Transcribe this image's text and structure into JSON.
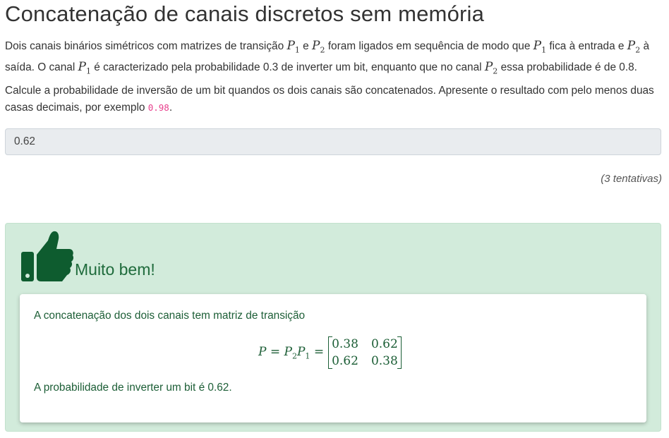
{
  "title": "Concatenação de canais discretos sem memória",
  "intro": {
    "t1": "Dois canais binários simétricos com matrizes de transição ",
    "m1": "P",
    "s1": "1",
    "t2": " e ",
    "m2": "P",
    "s2": "2",
    "t3": " foram ligados em sequência de modo que ",
    "m3": "P",
    "s3": "1",
    "t4": " fica à entrada e ",
    "m4": "P",
    "s4": "2",
    "t5": " à saída. O canal ",
    "m5": "P",
    "s5": "1",
    "t6": " é caracterizado pela probabilidade 0.3 de inverter um bit, enquanto que no canal ",
    "m6": "P",
    "s6": "2",
    "t7": " essa probabilidade é de 0.8."
  },
  "instruction": {
    "text": "Calcule a probabilidade de inversão de um bit quandos os dois canais são concatenados. Apresente o resultado com pelo menos duas casas decimais, por exemplo ",
    "example": "0.98",
    "end": "."
  },
  "answer": {
    "value": "0.62"
  },
  "attempts": "(3 tentativas)",
  "feedback": {
    "title": "Muito bem!",
    "icon": "thumbs-up-icon",
    "line1": "A concatenação dos dois canais tem matriz de transição",
    "equation": {
      "lhs_p": "P",
      "eq1": "=",
      "p2": "P",
      "p2sub": "2",
      "p1": "P",
      "p1sub": "1",
      "eq2": "=",
      "matrix": [
        "0.38",
        "0.62",
        "0.62",
        "0.38"
      ]
    },
    "line2": "A probabilidade de inverter um bit é 0.62."
  },
  "colors": {
    "success_bg": "#d2ebdb",
    "success_text": "#1c5e36",
    "code": "#e83e8c"
  }
}
